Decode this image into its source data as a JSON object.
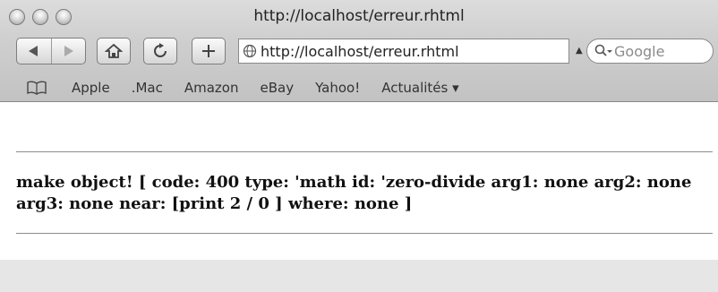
{
  "window": {
    "title": "http://localhost/erreur.rhtml"
  },
  "toolbar": {
    "url": "http://localhost/erreur.rhtml",
    "search_placeholder": "Google"
  },
  "bookmarks": {
    "items": [
      "Apple",
      ".Mac",
      "Amazon",
      "eBay",
      "Yahoo!",
      "Actualités ▾"
    ]
  },
  "page": {
    "message": "make object! [ code: 400 type: 'math id: 'zero-divide arg1: none arg2: none arg3: none near: [print 2 / 0 ] where: none ]"
  }
}
